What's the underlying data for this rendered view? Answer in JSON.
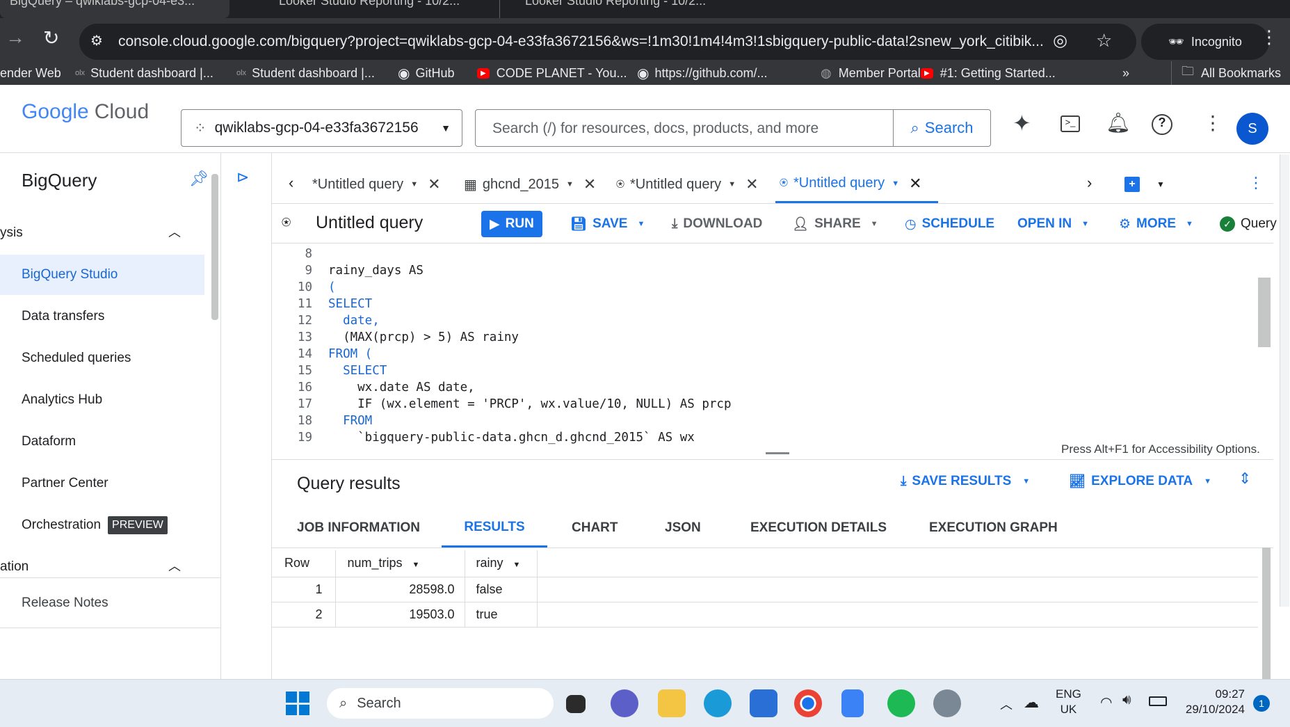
{
  "browser": {
    "tabs": [
      {
        "title": "BigQuery – qwiklabs-gcp-04-e3..."
      },
      {
        "title": "Looker Studio Reporting - 10/2..."
      },
      {
        "title": "Looker Studio Reporting - 10/2..."
      }
    ],
    "url": "console.cloud.google.com/bigquery?project=qwiklabs-gcp-04-e33fa3672156&ws=!1m30!1m4!4m3!1sbigquery-public-data!2snew_york_citibik...",
    "incognito_label": "Incognito",
    "bookmarks": [
      {
        "label": "ender Web"
      },
      {
        "label": "Student dashboard |..."
      },
      {
        "label": "Student dashboard |..."
      },
      {
        "label": "GitHub"
      },
      {
        "label": "CODE PLANET - You..."
      },
      {
        "label": "https://github.com/..."
      },
      {
        "label": "Member Portal"
      },
      {
        "label": "#1: Getting Started..."
      }
    ],
    "all_bookmarks": "All Bookmarks"
  },
  "header": {
    "logo_google": "Google",
    "logo_cloud": "Cloud",
    "project": "qwiklabs-gcp-04-e33fa3672156",
    "search_placeholder": "Search (/) for resources, docs, products, and more",
    "search_button": "Search",
    "avatar_letter": "S"
  },
  "sidebar": {
    "title": "BigQuery",
    "section1": "ysis",
    "items": [
      {
        "label": "BigQuery Studio"
      },
      {
        "label": "Data transfers"
      },
      {
        "label": "Scheduled queries"
      },
      {
        "label": "Analytics Hub"
      },
      {
        "label": "Dataform"
      },
      {
        "label": "Partner Center"
      },
      {
        "label": "Orchestration"
      }
    ],
    "preview_badge": "PREVIEW",
    "section2": "ation",
    "release_notes": "Release Notes"
  },
  "editor_tabs": [
    {
      "label": "*Untitled query"
    },
    {
      "label": "ghcnd_2015"
    },
    {
      "label": "*Untitled query"
    },
    {
      "label": "*Untitled query"
    }
  ],
  "toolbar": {
    "title": "Untitled query",
    "run": "RUN",
    "save": "SAVE",
    "download": "DOWNLOAD",
    "share": "SHARE",
    "schedule": "SCHEDULE",
    "open_in": "OPEN IN",
    "more": "MORE",
    "query_status": "Query"
  },
  "code_lines": [
    {
      "n": "8",
      "text": ""
    },
    {
      "n": "9",
      "text": "rainy_days AS"
    },
    {
      "n": "10",
      "text": "("
    },
    {
      "n": "11",
      "text": "SELECT"
    },
    {
      "n": "12",
      "text": "  date,"
    },
    {
      "n": "13",
      "text": "  (MAX(prcp) > 5) AS rainy"
    },
    {
      "n": "14",
      "text": "FROM ("
    },
    {
      "n": "15",
      "text": "  SELECT"
    },
    {
      "n": "16",
      "text": "    wx.date AS date,"
    },
    {
      "n": "17",
      "text": "    IF (wx.element = 'PRCP', wx.value/10, NULL) AS prcp"
    },
    {
      "n": "18",
      "text": "  FROM"
    },
    {
      "n": "19",
      "text": "    `bigquery-public-data.ghcn_d.ghcnd_2015` AS wx"
    }
  ],
  "accessibility_hint": "Press Alt+F1 for Accessibility Options.",
  "results": {
    "title": "Query results",
    "save_results": "SAVE RESULTS",
    "explore_data": "EXPLORE DATA",
    "tabs": [
      {
        "label": "JOB INFORMATION"
      },
      {
        "label": "RESULTS"
      },
      {
        "label": "CHART"
      },
      {
        "label": "JSON"
      },
      {
        "label": "EXECUTION DETAILS"
      },
      {
        "label": "EXECUTION GRAPH"
      }
    ],
    "columns": [
      {
        "label": "Row"
      },
      {
        "label": "num_trips"
      },
      {
        "label": "rainy"
      }
    ],
    "rows": [
      {
        "row": "1",
        "num_trips": "28598.0",
        "rainy": "false"
      },
      {
        "row": "2",
        "num_trips": "19503.0",
        "rainy": "true"
      }
    ]
  },
  "taskbar": {
    "search": "Search",
    "lang1": "ENG",
    "lang2": "UK",
    "time": "09:27",
    "date": "29/10/2024",
    "notif_count": "1"
  }
}
